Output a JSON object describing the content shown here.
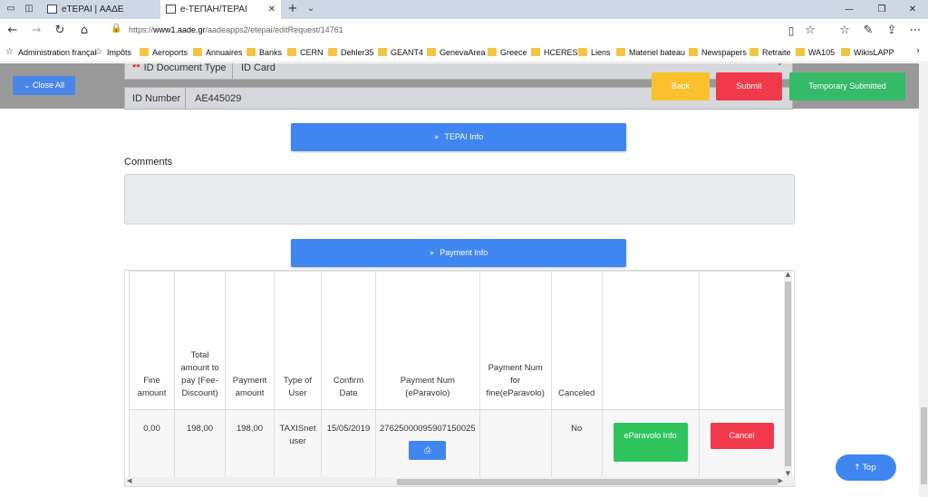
{
  "browser": {
    "tabs": [
      {
        "title": "eTEPAI | ΑΑΔΕ",
        "active": false
      },
      {
        "title": "e-ΤΕΠΑΗ/ΤΕΡΑΙ",
        "active": true
      }
    ],
    "tab_close_glyph": "✕",
    "new_tab_glyph": "+",
    "tab_list_glyph": "⌄",
    "window_controls": {
      "minimize": "—",
      "restore": "❐",
      "close": "✕"
    },
    "nav": {
      "back": "←",
      "forward": "→",
      "refresh": "↻",
      "home": "⌂"
    },
    "address": {
      "lock_glyph": "🔒",
      "prefix": "https://",
      "domain": "www1.aade.gr",
      "path": "/aadeapps2/etepai/editRequest/14761"
    },
    "toolbar_icons": {
      "reading": "▯",
      "favorite": "☆",
      "favorites_hub": "☆",
      "pen": "✎",
      "share": "⇪",
      "more": "⋯"
    },
    "favorites": [
      {
        "label": "Administration françai",
        "icon": "star-icon"
      },
      {
        "label": "Impôts",
        "icon": "star-icon"
      },
      {
        "label": "Aeroports",
        "icon": "folder-icon"
      },
      {
        "label": "Annuaires",
        "icon": "folder-icon"
      },
      {
        "label": "Banks",
        "icon": "folder-icon"
      },
      {
        "label": "CERN",
        "icon": "folder-icon"
      },
      {
        "label": "Dehler35",
        "icon": "folder-icon"
      },
      {
        "label": "GEANT4",
        "icon": "folder-icon"
      },
      {
        "label": "GenevaArea",
        "icon": "folder-icon"
      },
      {
        "label": "Greece",
        "icon": "folder-icon"
      },
      {
        "label": "HCERES",
        "icon": "folder-icon"
      },
      {
        "label": "Liens",
        "icon": "folder-icon"
      },
      {
        "label": "Materiel bateau",
        "icon": "folder-icon"
      },
      {
        "label": "Newspapers",
        "icon": "folder-icon"
      },
      {
        "label": "Retraite",
        "icon": "folder-icon"
      },
      {
        "label": "WA105",
        "icon": "folder-icon"
      },
      {
        "label": "WikisLAPP",
        "icon": "folder-icon"
      }
    ],
    "favorites_more_glyph": "›"
  },
  "page": {
    "close_all_label": "⌄ Close All",
    "back_label": "Back",
    "submit_label": "Submit",
    "temp_submitted_label": "Temporary Submitted",
    "id_document_type": {
      "required_mark": "**",
      "label": "ID Document Type",
      "value": "ID Card",
      "chevron": "⌄"
    },
    "id_number": {
      "label": "ID Number",
      "value": "AE445029"
    },
    "tepai_info_label": "TEPAI Info",
    "section_glyph": "»",
    "comments_label": "Comments",
    "payment_info_label": "Payment Info",
    "payment_table": {
      "headers": [
        "Fine amount",
        "Total amount to pay (Fee-Discount)",
        "Payment amount",
        "Type of User",
        "Confirm Date",
        "Payment Num (eParavolo)",
        "Payment Num for fine(eParavolo)",
        "Canceled",
        "",
        ""
      ],
      "row": {
        "fine_amount": "0,00",
        "total_amount": "198,00",
        "payment_amount": "198,00",
        "user_type": "TAXISnet user",
        "confirm_date": "15/05/2019",
        "payment_num": "27625000095907150025",
        "payment_num_fine": "",
        "canceled": "No",
        "print_glyph": "⎙",
        "eparavolo_label": "eParavolo Info",
        "cancel_label": "Cancel"
      }
    },
    "top_label": "Top",
    "top_glyph": "↑"
  },
  "colors": {
    "primary": "#3f86f0",
    "warning": "#fbc02d",
    "danger": "#f1394b",
    "success": "#35bb67"
  }
}
